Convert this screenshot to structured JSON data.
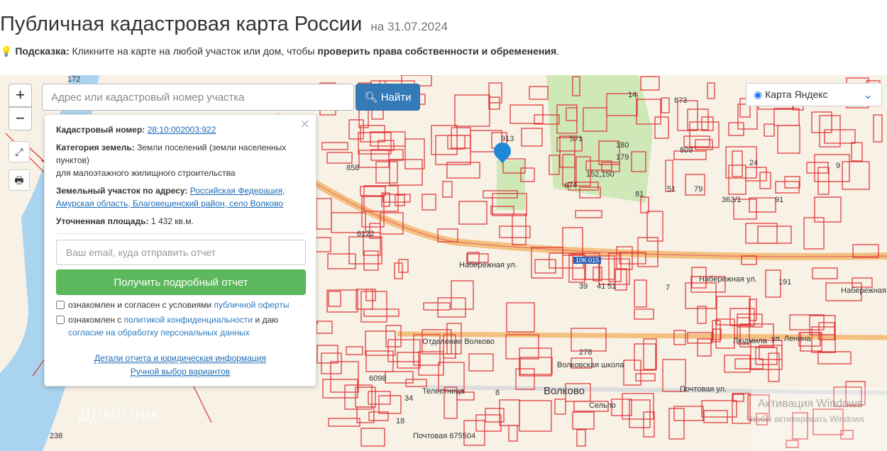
{
  "header": {
    "title": "Публичная кадастровая карта России",
    "date": "на 31.07.2024"
  },
  "hint": {
    "label": "Подсказка:",
    "text": "Кликните на карте на любой участок или дом, чтобы",
    "bold": "проверить права собственности и обременения",
    "end": "."
  },
  "map": {
    "zoom_in": "+",
    "zoom_out": "−",
    "search_placeholder": "Адрес или кадастровый номер участка",
    "search_button": "Найти",
    "layer_select": "Карта Яндекс",
    "labels": [
      "172",
      "14",
      "873",
      "913",
      "571",
      "180",
      "179",
      "152,150",
      "809",
      "24",
      "9",
      "858",
      "674",
      "81",
      "51",
      "79",
      "363/1",
      "91",
      "6122",
      "10К-015",
      "Набережная ул.",
      "Набережная ул.",
      "191",
      "Набережная ул.",
      "39",
      "41",
      "51",
      "7",
      "ул. Ленина",
      "Людмила",
      "278",
      "Волковская школа",
      "Волково",
      "Почтовая ул.",
      "Сельпо",
      "6098",
      "238",
      "Отделение Волково",
      "Телестница",
      "8",
      "34",
      "18",
      "Почтовая 675504",
      "Активация Windows",
      "Чтобы активировать Windows",
      "ДомКлик"
    ]
  },
  "popup": {
    "cad_label": "Кадастровый номер:",
    "cad_value": "28:10:002003:922",
    "cat_label": "Категория земель:",
    "cat_value": "Земли поселений (земли населенных пунктов)",
    "cat_use": "для малоэтажного жилищного строительства",
    "addr_label": "Земельный участок по адресу:",
    "addr_value": "Российская Федерация, Амурская область, Благовещенский район, село Волково",
    "area_label": "Уточненная площадь:",
    "area_value": "1 432 кв.м.",
    "email_placeholder": "Ваш email, куда отправить отчет",
    "report_button": "Получить подробный отчет",
    "cb1_text": "ознакомлен и согласен с условиями",
    "cb1_link": "публичной оферты",
    "cb2_text": "ознакомлен с",
    "cb2_link": "политикой конфиденциальности",
    "cb2_mid": "и даю",
    "cb2_link2": "согласие на обработку персональных данных",
    "details_link": "Детали отчета и юридическая информация",
    "manual_link": "Ручной выбор вариантов",
    "close": "×"
  },
  "colors": {
    "primary": "#337ab7",
    "success": "#5cb85c",
    "parcel": "#e03030"
  }
}
